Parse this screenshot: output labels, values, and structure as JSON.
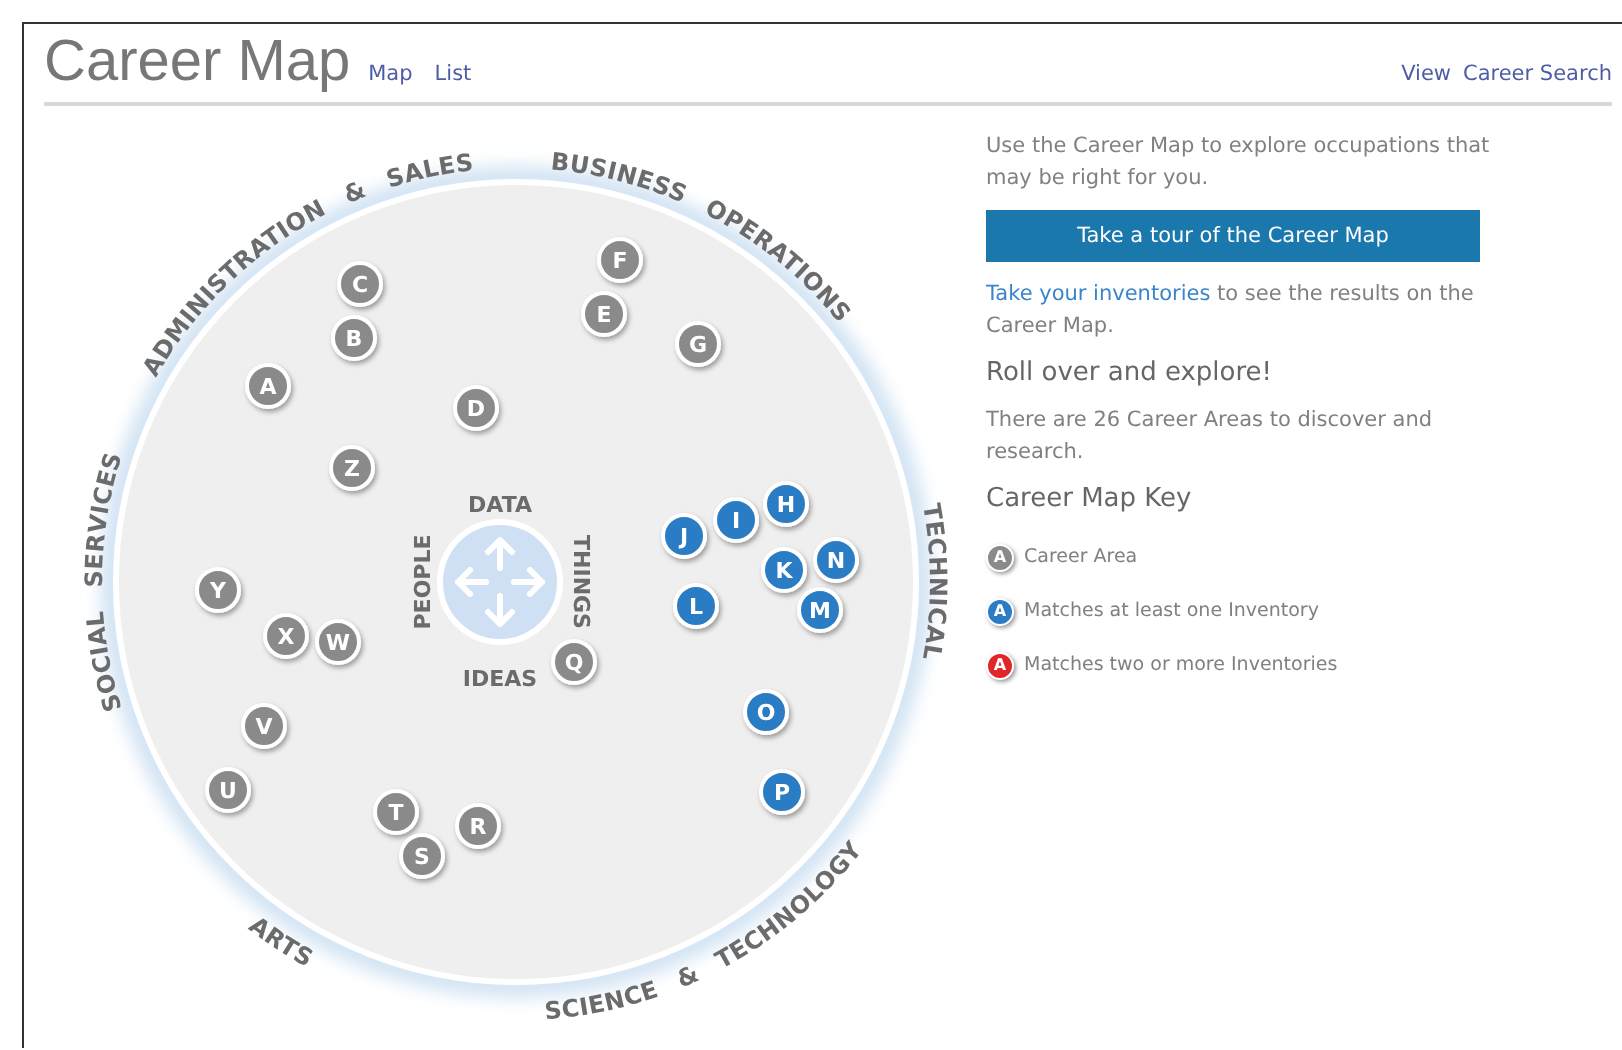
{
  "header": {
    "title": "Career Map",
    "links": [
      "Map",
      "List"
    ],
    "right_links": [
      "View",
      "Career Search"
    ]
  },
  "map": {
    "regions": [
      "SOCIAL SERVICES",
      "ADMINISTRATION & SALES",
      "BUSINESS OPERATIONS",
      "TECHNICAL",
      "ARTS",
      "SCIENCE & TECHNOLOGY"
    ],
    "axes": [
      "DATA",
      "THINGS",
      "IDEAS",
      "PEOPLE"
    ],
    "areas": [
      {
        "letter": "F",
        "color": "#8a8a8a"
      },
      {
        "letter": "C",
        "color": "#8a8a8a"
      },
      {
        "letter": "E",
        "color": "#8a8a8a"
      },
      {
        "letter": "B",
        "color": "#8a8a8a"
      },
      {
        "letter": "G",
        "color": "#8a8a8a"
      },
      {
        "letter": "A",
        "color": "#8a8a8a"
      },
      {
        "letter": "D",
        "color": "#8a8a8a"
      },
      {
        "letter": "Z",
        "color": "#8a8a8a"
      },
      {
        "letter": "H",
        "color": "#2a7cc4"
      },
      {
        "letter": "I",
        "color": "#2a7cc4"
      },
      {
        "letter": "J",
        "color": "#2a7cc4"
      },
      {
        "letter": "N",
        "color": "#2a7cc4"
      },
      {
        "letter": "K",
        "color": "#2a7cc4"
      },
      {
        "letter": "Y",
        "color": "#8a8a8a"
      },
      {
        "letter": "L",
        "color": "#2a7cc4"
      },
      {
        "letter": "M",
        "color": "#2a7cc4"
      },
      {
        "letter": "X",
        "color": "#8a8a8a"
      },
      {
        "letter": "W",
        "color": "#8a8a8a"
      },
      {
        "letter": "Q",
        "color": "#8a8a8a"
      },
      {
        "letter": "O",
        "color": "#2a7cc4"
      },
      {
        "letter": "V",
        "color": "#8a8a8a"
      },
      {
        "letter": "U",
        "color": "#8a8a8a"
      },
      {
        "letter": "P",
        "color": "#2a7cc4"
      },
      {
        "letter": "T",
        "color": "#8a8a8a"
      },
      {
        "letter": "R",
        "color": "#8a8a8a"
      },
      {
        "letter": "S",
        "color": "#8a8a8a"
      }
    ]
  },
  "panel": {
    "intro": "Use the Career Map to explore occupations that may be right for you.",
    "tour_button": "Take a tour of the Career Map",
    "inventories_link": "Take your inventories",
    "inventories_text": "to see the results on the Career Map.",
    "explore_heading": "Roll over and explore!",
    "areas_text": "There are 26 Career Areas to discover and research.",
    "key_heading": "Career Map Key",
    "key": [
      {
        "letter": "A",
        "label": "Career Area",
        "color": "#8a8a8a"
      },
      {
        "letter": "A",
        "label": "Matches at least one Inventory",
        "color": "#2a7cc4"
      },
      {
        "letter": "A",
        "label": "Matches two or more Inventories",
        "color": "#e0262a"
      }
    ]
  }
}
